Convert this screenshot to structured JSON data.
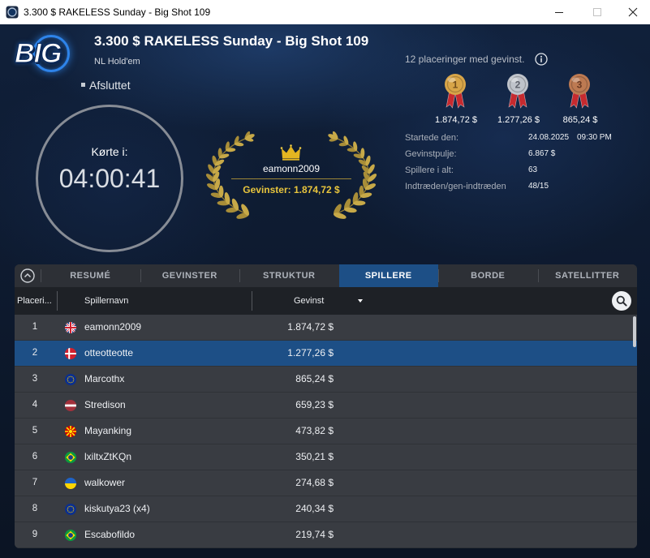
{
  "window": {
    "title": "3.300 $ RAKELESS Sunday - Big Shot 109",
    "app_icon": "poker-app-icon",
    "controls": {
      "minimize": "minimize-icon",
      "maximize": "maximize-icon",
      "close": "close-icon"
    }
  },
  "header": {
    "logo_text": "BIG",
    "title": "3.300 $ RAKELESS Sunday - Big Shot 109",
    "game_type": "NL Hold'em",
    "status": "Afsluttet"
  },
  "timer": {
    "label": "Kørte i:",
    "value": "04:00:41"
  },
  "winner": {
    "icon": "crown-icon",
    "wreath_icon": "laurel-wreath-icon",
    "name": "eamonn2009",
    "winnings": "Gevinster: 1.874,72 $"
  },
  "prizes": {
    "summary": "12 placeringer med gevinst.",
    "info_icon": "info-icon",
    "medals": [
      {
        "place": "1",
        "amount": "1.874,72 $",
        "color": "#d8a548",
        "icon": "gold-medal-icon"
      },
      {
        "place": "2",
        "amount": "1.277,26 $",
        "color": "#bfc3ca",
        "icon": "silver-medal-icon"
      },
      {
        "place": "3",
        "amount": "865,24 $",
        "color": "#bd7a52",
        "icon": "bronze-medal-icon"
      }
    ],
    "ribbon_color": "#c62a2f"
  },
  "details": {
    "started": {
      "label": "Startede den:",
      "date": "24.08.2025",
      "time": "09:30 PM"
    },
    "prize_pool": {
      "label": "Gevinstpulje:",
      "value": "6.867 $"
    },
    "players": {
      "label": "Spillere i alt:",
      "value": "63"
    },
    "entries": {
      "label": "Indtræden/gen-indtræden",
      "value": "48/15"
    }
  },
  "tabs": {
    "collapse_icon": "chevron-up-circle-icon",
    "items": [
      "RESUMÉ",
      "GEVINSTER",
      "STRUKTUR",
      "SPILLERE",
      "BORDE",
      "SATELLITTER"
    ],
    "active": "SPILLERE"
  },
  "table": {
    "columns": {
      "place": "Placeri...",
      "player": "Spillernavn",
      "winnings": "Gevinst"
    },
    "sort_icon": "sort-descending-icon",
    "search_icon": "search-icon",
    "selected_row": "2",
    "rows": [
      {
        "place": "1",
        "flag": "uk-flag-icon",
        "name": "eamonn2009",
        "winnings": "1.874,72 $"
      },
      {
        "place": "2",
        "flag": "denmark-flag-icon",
        "name": "otteotteotte",
        "winnings": "1.277,26 $"
      },
      {
        "place": "3",
        "flag": "eu-flag-icon",
        "name": "Marcothx",
        "winnings": "865,24 $"
      },
      {
        "place": "4",
        "flag": "latvia-flag-icon",
        "name": "Stredison",
        "winnings": "659,23 $"
      },
      {
        "place": "5",
        "flag": "north-macedonia-flag-icon",
        "name": "Mayanking",
        "winnings": "473,82 $"
      },
      {
        "place": "6",
        "flag": "brazil-flag-icon",
        "name": "lxiltxZtKQn",
        "winnings": "350,21 $"
      },
      {
        "place": "7",
        "flag": "ukraine-flag-icon",
        "name": "walkower",
        "winnings": "274,68 $"
      },
      {
        "place": "8",
        "flag": "eu-flag-icon",
        "name": "kiskutya23 (x4)",
        "winnings": "240,34 $"
      },
      {
        "place": "9",
        "flag": "brazil-flag-icon",
        "name": "Escabofildo",
        "winnings": "219,74 $"
      }
    ]
  },
  "colors": {
    "accent": "#1d4f86",
    "gold_text": "#e8c53d",
    "background": "#0e1a2f"
  }
}
